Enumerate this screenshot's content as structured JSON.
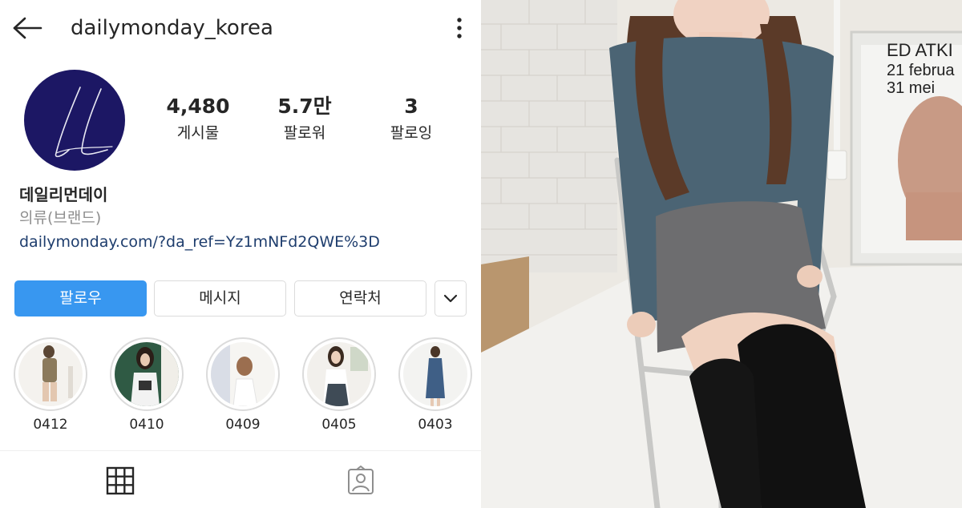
{
  "profile": {
    "username": "dailymonday_korea",
    "full_name": "데일리먼데이",
    "category": "의류(브랜드)",
    "website": "dailymonday.com/?da_ref=Yz1mNFd2QWE%3D",
    "stats": [
      {
        "value": "4,480",
        "label": "게시물"
      },
      {
        "value": "5.7만",
        "label": "팔로워"
      },
      {
        "value": "3",
        "label": "팔로잉"
      }
    ]
  },
  "actions": {
    "follow": "팔로우",
    "message": "메시지",
    "contact": "연락처"
  },
  "highlights": [
    {
      "label": "0412"
    },
    {
      "label": "0410"
    },
    {
      "label": "0409"
    },
    {
      "label": "0405"
    },
    {
      "label": "0403"
    }
  ],
  "icons": {
    "back": "arrow-left-icon",
    "more": "vertical-dots-icon",
    "expand": "chevron-down-icon",
    "grid": "grid-icon",
    "tagged": "tagged-user-icon"
  },
  "colors": {
    "accent": "#3897f0",
    "avatar_bg": "#1c1764",
    "link": "#1e3d6d",
    "muted": "#8e8e8e",
    "border": "#dbdbdb"
  },
  "photo": {
    "poster_lines": [
      "ED ATKI",
      "21 februa",
      "31 mei"
    ]
  }
}
